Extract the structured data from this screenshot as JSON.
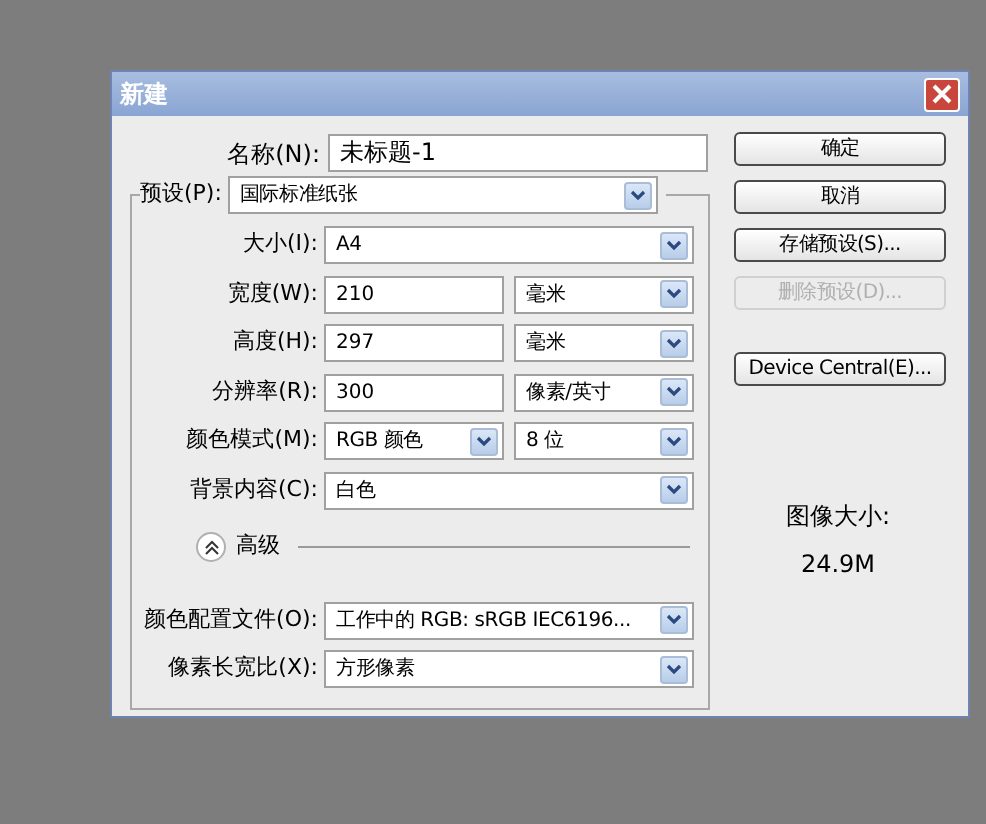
{
  "window": {
    "title": "新建"
  },
  "name_field": {
    "label": "名称(N):",
    "value": "未标题-1"
  },
  "preset": {
    "label": "预设(P):",
    "value": "国际标准纸张"
  },
  "rows": [
    {
      "label": "大小(I):",
      "controls": [
        {
          "kind": "select",
          "value": "A4",
          "disabled": false
        }
      ]
    },
    {
      "label": "宽度(W):",
      "controls": [
        {
          "kind": "input",
          "value": "210"
        },
        {
          "kind": "select",
          "value": "毫米",
          "disabled": false
        }
      ]
    },
    {
      "label": "高度(H):",
      "controls": [
        {
          "kind": "input",
          "value": "297"
        },
        {
          "kind": "select",
          "value": "毫米",
          "disabled": false
        }
      ]
    },
    {
      "label": "分辨率(R):",
      "controls": [
        {
          "kind": "input",
          "value": "300"
        },
        {
          "kind": "select",
          "value": "像素/英寸",
          "disabled": false
        }
      ]
    },
    {
      "label": "颜色模式(M):",
      "controls": [
        {
          "kind": "select",
          "value": "RGB 颜色",
          "disabled": false
        },
        {
          "kind": "select",
          "value": "8 位",
          "disabled": false
        }
      ]
    },
    {
      "label": "背景内容(C):",
      "controls": [
        {
          "kind": "select",
          "value": "白色",
          "disabled": false
        }
      ]
    }
  ],
  "advanced": {
    "label": "高级",
    "expanded": true
  },
  "advanced_rows": [
    {
      "label": "颜色配置文件(O):",
      "controls": [
        {
          "kind": "select",
          "value": "工作中的 RGB: sRGB IEC6196...",
          "disabled": false
        }
      ]
    },
    {
      "label": "像素长宽比(X):",
      "controls": [
        {
          "kind": "select",
          "value": "方形像素",
          "disabled": false
        }
      ]
    }
  ],
  "buttons": [
    {
      "label": "确定",
      "disabled": false
    },
    {
      "label": "取消",
      "disabled": false
    },
    {
      "label": "存储预设(S)...",
      "disabled": false
    },
    {
      "label": "删除预设(D)...",
      "disabled": true
    },
    {
      "label": "Device Central(E)...",
      "disabled": false
    }
  ],
  "image_size": {
    "label": "图像大小:",
    "value": "24.9M"
  }
}
